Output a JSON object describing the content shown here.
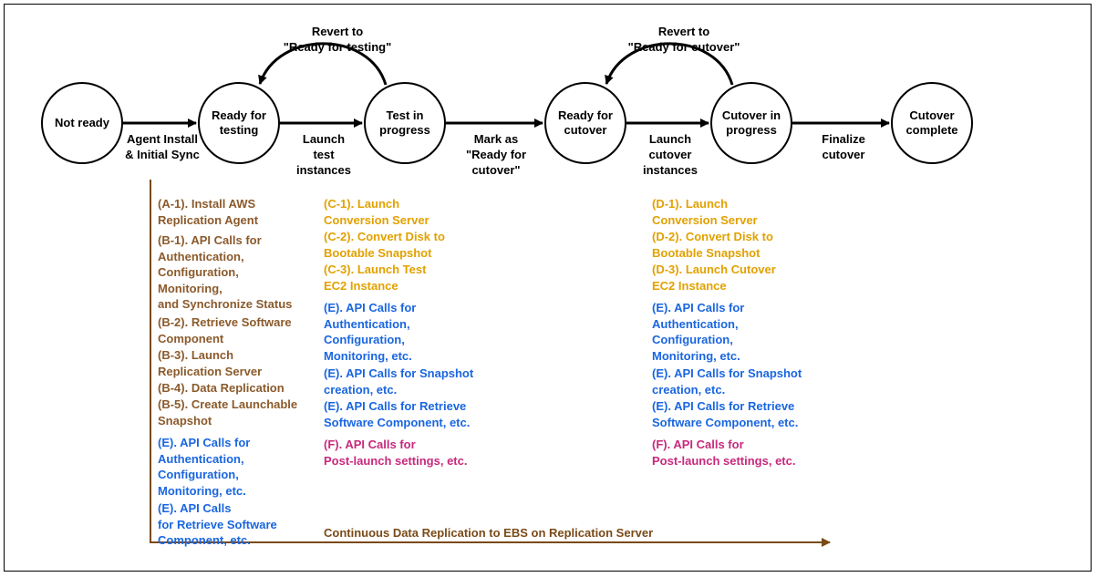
{
  "states": {
    "s1": "Not ready",
    "s2": "Ready for\ntesting",
    "s3": "Test in\nprogress",
    "s4": "Ready for\ncutover",
    "s5": "Cutover in\nprogress",
    "s6": "Cutover\ncomplete"
  },
  "transitions": {
    "t12": "Agent Install\n& Initial Sync",
    "t23": "Launch\ntest\ninstances",
    "t34": "Mark as\n\"Ready for\ncutover\"",
    "t45": "Launch\ncutover\ninstances",
    "t56": "Finalize\ncutover",
    "rev32": "Revert to\n\"Ready for testing\"",
    "rev54": "Revert to\n\"Ready for cutover\""
  },
  "notes": {
    "col1": {
      "a1": "(A-1). Install AWS\nReplication Agent",
      "b1": "(B-1). API Calls for\nAuthentication,\nConfiguration,\nMonitoring,\nand Synchronize Status",
      "b2": "(B-2). Retrieve Software\nComponent",
      "b3": "(B-3). Launch\nReplication Server",
      "b4": "(B-4). Data Replication",
      "b5": "(B-5). Create Launchable\nSnapshot",
      "e1": "(E). API Calls for\nAuthentication,\nConfiguration,\nMonitoring, etc.",
      "e2": "(E). API Calls\nfor Retrieve Software\nComponent, etc."
    },
    "col2": {
      "c1": "(C-1). Launch\nConversion Server",
      "c2": "(C-2). Convert Disk to\nBootable Snapshot",
      "c3": "(C-3). Launch Test\nEC2 Instance",
      "e1": "(E). API Calls for\nAuthentication,\nConfiguration,\nMonitoring, etc.",
      "e2": "(E). API Calls for Snapshot\ncreation, etc.",
      "e3": "(E). API Calls for Retrieve\nSoftware Component, etc.",
      "f1": "(F). API Calls for\nPost-launch settings, etc."
    },
    "col3": {
      "d1": "(D-1). Launch\nConversion Server",
      "d2": "(D-2). Convert Disk to\nBootable Snapshot",
      "d3": "(D-3). Launch Cutover\nEC2 Instance",
      "e1": "(E). API Calls for\nAuthentication,\nConfiguration,\nMonitoring, etc.",
      "e2": "(E). API Calls for Snapshot\ncreation, etc.",
      "e3": "(E). API Calls for Retrieve\nSoftware Component, etc.",
      "f1": "(F). API Calls for\nPost-launch settings, etc."
    }
  },
  "footer": "Continuous Data Replication to EBS on Replication Server"
}
